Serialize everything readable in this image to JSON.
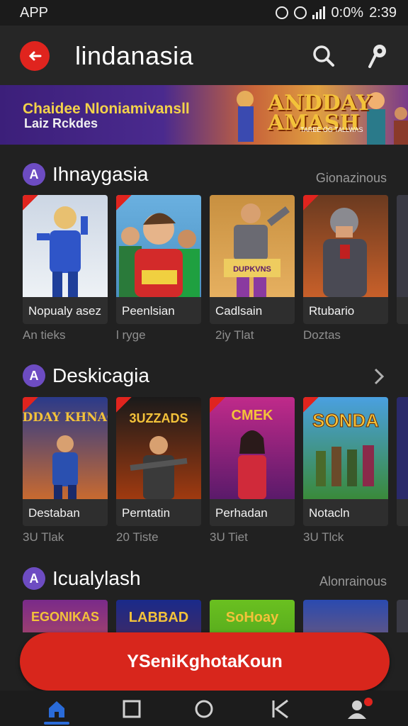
{
  "statusbar": {
    "left": "APP",
    "battery": "0:0%",
    "time": "2:39"
  },
  "appbar": {
    "title": "lindanasia"
  },
  "banner": {
    "title": "Chaidee Nloniamivansll",
    "subtitle": "Laiz Rckdes",
    "logo": "ANDDAY AMASH",
    "logo_sub": "TAREE OG TALLWAS"
  },
  "sections": [
    {
      "title": "Ihnaygasia",
      "badge": "A",
      "more": "Gionazinous",
      "cards": [
        {
          "name": "Nopualy asez",
          "sub": "An tieks"
        },
        {
          "name": "Peenlsian",
          "sub": "l ryge"
        },
        {
          "name": "Cadlsain",
          "sub": "2iy Tlat"
        },
        {
          "name": "Rtubario",
          "sub": "Doztas"
        }
      ]
    },
    {
      "title": "Deskicagia",
      "badge": "A",
      "more": "",
      "cards": [
        {
          "name": "Destaban",
          "sub": "3U Tlak"
        },
        {
          "name": "Perntatin",
          "sub": "20 Tiste"
        },
        {
          "name": "Perhadan",
          "sub": "3U Tiet"
        },
        {
          "name": "Notacln",
          "sub": "3U Tlck"
        }
      ]
    },
    {
      "title": "Icualylash",
      "badge": "A",
      "more": "Alonrainous",
      "cards": [
        {
          "name": "EGONIKAS"
        },
        {
          "name": "LABBAD"
        },
        {
          "name": "SoHoay"
        },
        {
          "name": ""
        }
      ]
    }
  ],
  "card_art_text": {
    "s1c3": "DUPKVNS",
    "s2c1": "ANDDAY KHNAON",
    "s2c2": "3UZZADS",
    "s2c3": "CMEK",
    "s2c4": "SONDA"
  },
  "cta": {
    "label": "YSeniKghotaKoun"
  },
  "colors": {
    "accent": "#d8261c",
    "section_badge": "#6d4cc2",
    "background": "#212121"
  },
  "icons": [
    "back-arrow-icon",
    "search-icon",
    "location-pin-icon",
    "home-icon",
    "square-icon",
    "circle-icon",
    "back-chevron-icon",
    "profile-icon"
  ]
}
